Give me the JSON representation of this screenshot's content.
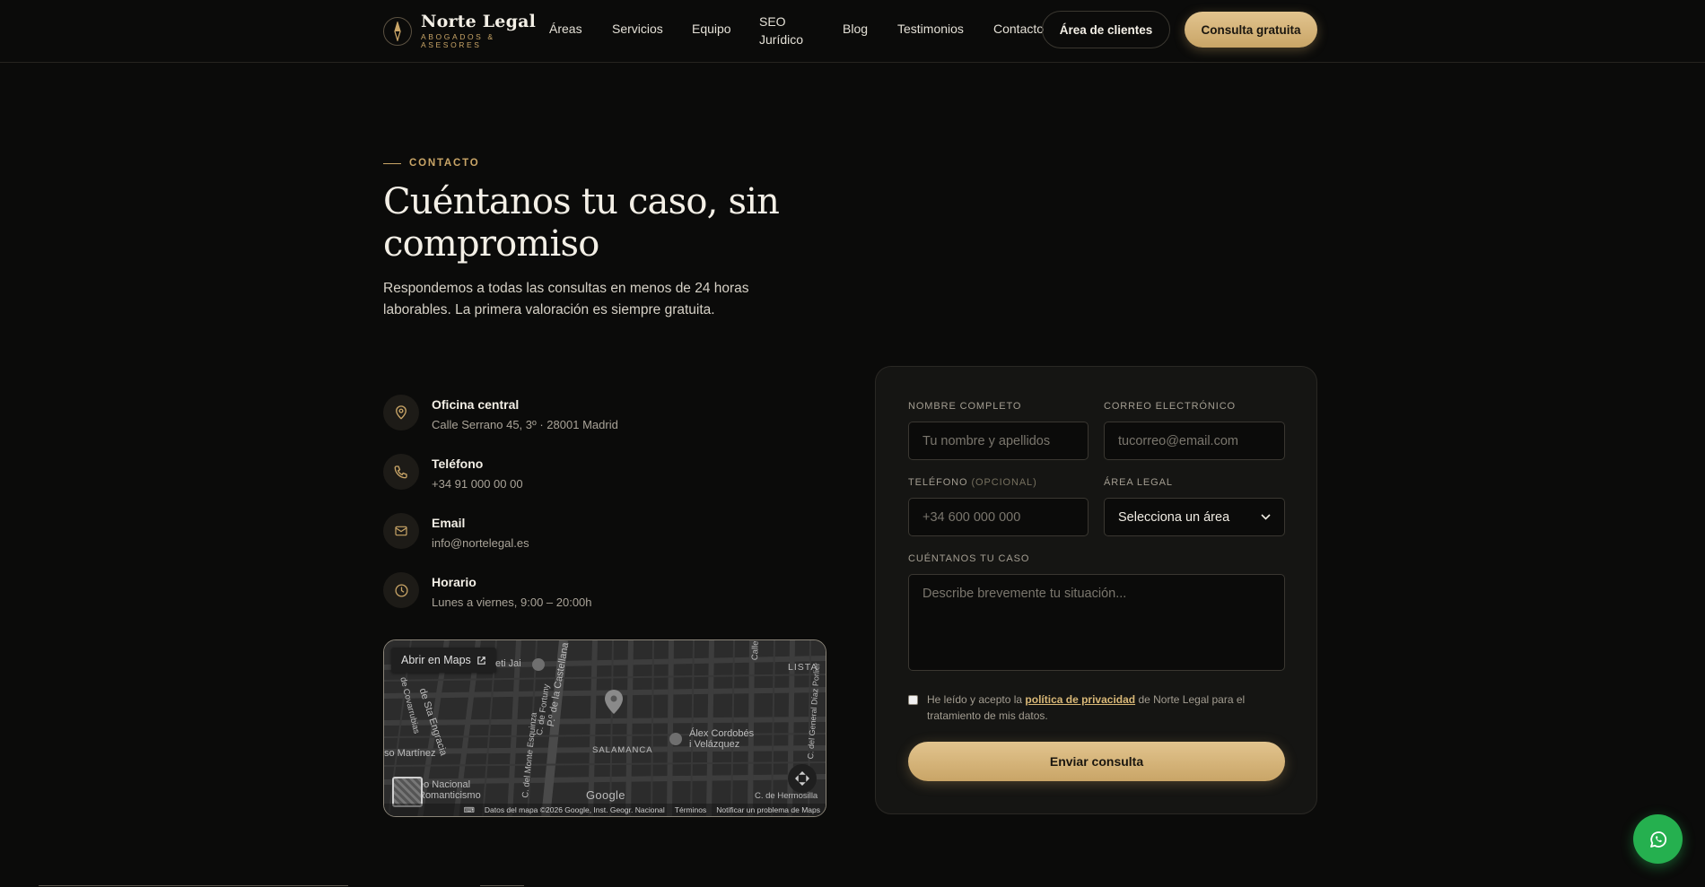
{
  "brand": {
    "name": "Norte Legal",
    "tagline": "ABOGADOS & ASESORES"
  },
  "nav": {
    "items": [
      "Áreas",
      "Servicios",
      "Equipo",
      "SEO Jurídico",
      "Blog",
      "Testimonios",
      "Contacto"
    ],
    "clients_button": "Área de clientes",
    "cta_button": "Consulta gratuita"
  },
  "hero": {
    "eyebrow": "CONTACTO",
    "title": "Cuéntanos tu caso, sin compromiso",
    "subtitle": "Respondemos a todas las consultas en menos de 24 horas laborables. La primera valoración es siempre gratuita."
  },
  "contact": [
    {
      "label": "Oficina central",
      "value": "Calle Serrano 45, 3º · 28001 Madrid",
      "icon": "map-pin-icon"
    },
    {
      "label": "Teléfono",
      "value": "+34 91 000 00 00",
      "icon": "phone-icon"
    },
    {
      "label": "Email",
      "value": "info@nortelegal.es",
      "icon": "mail-icon"
    },
    {
      "label": "Horario",
      "value": "Lunes a viernes, 9:00 – 20:00h",
      "icon": "clock-icon"
    }
  ],
  "map": {
    "open_button": "Abrir en Maps",
    "labels": {
      "jai": "eti Jai",
      "castellana": "P.º de la Castellana",
      "fortuny": "C. de Fortuny",
      "monte": "C. del Monte Esquinza",
      "engracia": "de Sta Engracia",
      "covarrubias": "de Covarrubias",
      "martinez": "so Martínez",
      "salamanca": "SALAMANCA",
      "alex": "Álex Cordobés\ni Velázquez",
      "lista": "LISTA",
      "diaz": "C. del General Díaz Porlier",
      "hermosilla": "C. de Hermosilla",
      "museo": "eo Nacional\nRomanticismo",
      "calle": "Calle"
    },
    "google": "Google",
    "attribution": "Datos del mapa ©2026 Google, Inst. Geogr. Nacional",
    "terms": "Términos",
    "report": "Notificar un problema de Maps"
  },
  "form": {
    "name_label": "NOMBRE COMPLETO",
    "name_placeholder": "Tu nombre y apellidos",
    "email_label": "CORREO ELECTRÓNICO",
    "email_placeholder": "tucorreo@email.com",
    "phone_label": "TELÉFONO",
    "phone_optional": "(OPCIONAL)",
    "phone_placeholder": "+34 600 000 000",
    "area_label": "ÁREA LEGAL",
    "area_selected": "Selecciona un área",
    "case_label": "CUÉNTANOS TU CASO",
    "case_placeholder": "Describe brevemente tu situación...",
    "privacy_prefix": "He leído y acepto la ",
    "privacy_link": "política de privacidad",
    "privacy_suffix": " de Norte Legal para el tratamiento de mis datos.",
    "submit": "Enviar consulta"
  },
  "colors": {
    "accent": "#c9a567",
    "background": "#0b0b0a",
    "whatsapp": "#25b04f"
  }
}
